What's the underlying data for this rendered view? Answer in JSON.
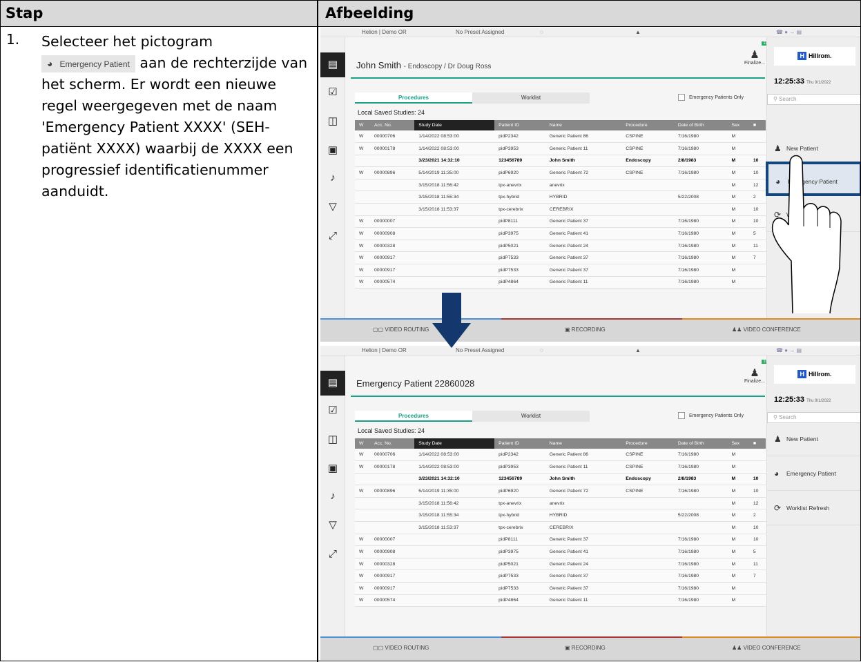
{
  "header": {
    "col1": "Stap",
    "col2": "Afbeelding"
  },
  "step": {
    "number": "1.",
    "text_before": "Selecteer het pictogram",
    "inline_button_label": "Emergency Patient",
    "text_after": "aan de rechterzijde van het scherm. Er wordt een nieuwe regel weergegeven met de naam 'Emergency Patient XXXX' (SEH-patiënt XXXX) waarbij de XXXX een progressief identificatienummer aanduidt."
  },
  "app": {
    "location": "Helion | Demo OR",
    "preset": "No Preset Assigned",
    "finalize": "Finalize...",
    "finalize_count": "10",
    "brand": "Hillrom.",
    "time": "12:25:33",
    "date": "Thu 9/1/2022",
    "search_placeholder": "Search",
    "new_patient": "New Patient",
    "emergency_patient": "Emergency Patient",
    "worklist_refresh": "Worklist Refresh",
    "tab_procedures": "Procedures",
    "tab_worklist": "Worklist",
    "emergency_only": "Emergency Patients Only",
    "local_saved": "Local Saved Studies: 24",
    "video_routing": "VIDEO ROUTING",
    "recording": "RECORDING",
    "video_conference": "VIDEO CONFERENCE"
  },
  "screen1": {
    "patient_name": "John Smith",
    "patient_sub": "- Endoscopy / Dr Doug Ross"
  },
  "screen2": {
    "patient_name": "Emergency Patient 22860028",
    "patient_sub": ""
  },
  "columns": [
    "W",
    "Acc. No.",
    "Study Date",
    "Patient ID",
    "Name",
    "Procedure",
    "Date of Birth",
    "Sex",
    ""
  ],
  "rows": [
    [
      "W",
      "00000706",
      "1/14/2022 08:53:00",
      "pidP2342",
      "Generic Patient 86",
      "CSPINE",
      "7/16/1980",
      "M",
      ""
    ],
    [
      "W",
      "00000178",
      "1/14/2022 08:53:00",
      "pidP3953",
      "Generic Patient 11",
      "CSPINE",
      "7/16/1980",
      "M",
      ""
    ],
    [
      "",
      "",
      "3/23/2021 14:32:10",
      "123456789",
      "John Smith",
      "Endoscopy",
      "2/8/1983",
      "M",
      "10"
    ],
    [
      "W",
      "00000896",
      "5/14/2019 11:35:00",
      "pidP6920",
      "Generic Patient 72",
      "CSPINE",
      "7/16/1980",
      "M",
      "10"
    ],
    [
      "",
      "",
      "3/15/2018 11:56:42",
      "tpx-anevrix",
      "anevrix",
      "",
      "",
      "M",
      "12"
    ],
    [
      "",
      "",
      "3/15/2018 11:55:34",
      "tpx-hybrid",
      "HYBRID",
      "",
      "5/22/2008",
      "M",
      "2"
    ],
    [
      "",
      "",
      "3/15/2018 11:53:37",
      "tpx-cerebrix",
      "CEREBRIX",
      "",
      "",
      "M",
      "10"
    ],
    [
      "W",
      "00000007",
      "",
      "pidP8111",
      "Generic Patient 37",
      "",
      "7/16/1980",
      "M",
      "10"
    ],
    [
      "W",
      "00000908",
      "",
      "pidP3975",
      "Generic Patient 41",
      "",
      "7/16/1980",
      "M",
      "5"
    ],
    [
      "W",
      "00000328",
      "",
      "pidP5021",
      "Generic Patient 24",
      "",
      "7/16/1980",
      "M",
      "11"
    ],
    [
      "W",
      "00000917",
      "",
      "pidP7533",
      "Generic Patient 37",
      "",
      "7/16/1980",
      "M",
      "7"
    ],
    [
      "W",
      "00000917",
      "",
      "pidP7533",
      "Generic Patient 37",
      "",
      "7/16/1980",
      "M",
      ""
    ],
    [
      "W",
      "00000574",
      "",
      "pidP4864",
      "Generic Patient 11",
      "",
      "7/16/1980",
      "M",
      ""
    ]
  ]
}
